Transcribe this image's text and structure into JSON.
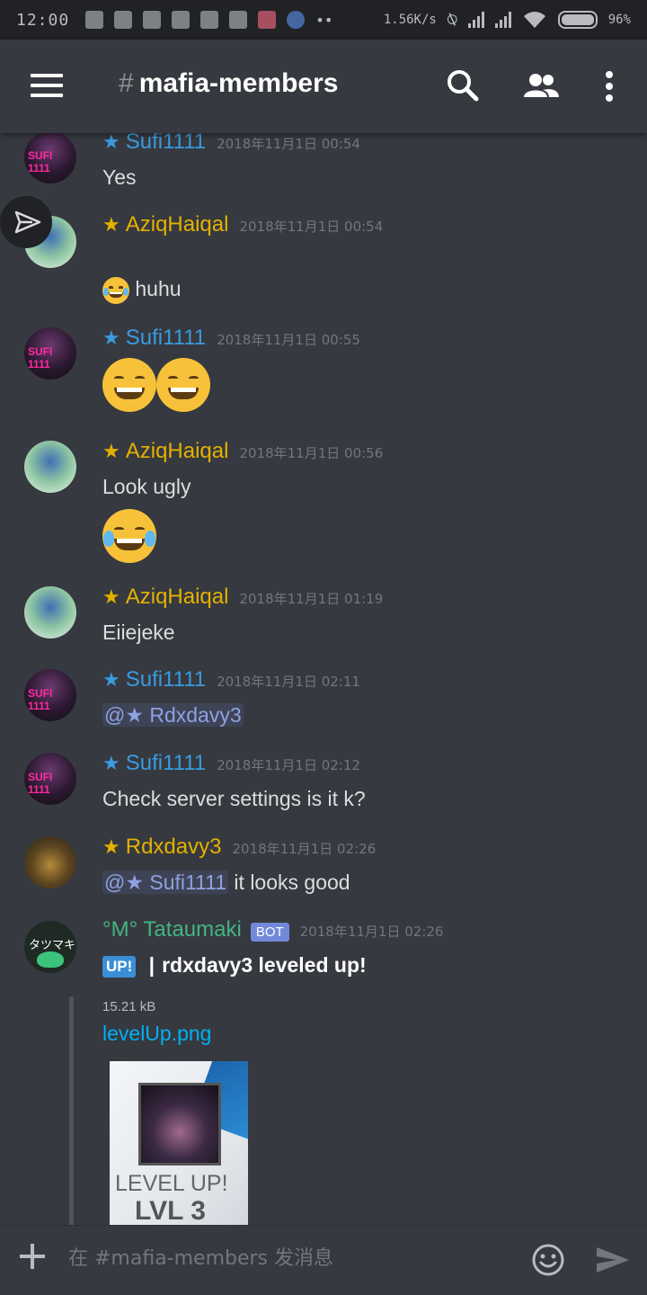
{
  "status_bar": {
    "time": "12:00",
    "network_speed": "1.56K/s",
    "battery": "96%"
  },
  "header": {
    "hash": "#",
    "channel": "mafia-members"
  },
  "messages": [
    {
      "author": "Sufi1111",
      "role_star": "★",
      "color": "#3a9be0",
      "timestamp": "2018年11月1日 00:54",
      "text": "Yes",
      "avatar": "sufi-avatar"
    },
    {
      "author": "AziqHaiqal",
      "role_star": "★",
      "color": "#e3b100",
      "timestamp": "2018年11月1日 00:54",
      "text": "huhu",
      "emoji_before_text": "sob-emoji",
      "avatar": "aziq-avatar"
    },
    {
      "author": "Sufi1111",
      "role_star": "★",
      "color": "#3a9be0",
      "timestamp": "2018年11月1日 00:55",
      "emojis": [
        "grin-emoji",
        "grin-emoji"
      ],
      "avatar": "sufi-avatar"
    },
    {
      "author": "AziqHaiqal",
      "role_star": "★",
      "color": "#e3b100",
      "timestamp": "2018年11月1日 00:56",
      "text": "Look ugly",
      "emojis": [
        "joy-emoji"
      ],
      "avatar": "aziq-avatar"
    },
    {
      "author": "AziqHaiqal",
      "role_star": "★",
      "color": "#e3b100",
      "timestamp": "2018年11月1日 01:19",
      "text": "Eiiejeke",
      "avatar": "aziq-avatar"
    },
    {
      "author": "Sufi1111",
      "role_star": "★",
      "color": "#3a9be0",
      "timestamp": "2018年11月1日 02:11",
      "mention": "@★ Rdxdavy3",
      "avatar": "sufi-avatar"
    },
    {
      "author": "Sufi1111",
      "role_star": "★",
      "color": "#3a9be0",
      "timestamp": "2018年11月1日 02:12",
      "text": "Check server settings is it k?",
      "avatar": "sufi-avatar"
    },
    {
      "author": "Rdxdavy3",
      "role_star": "★",
      "color": "#e3b100",
      "timestamp": "2018年11月1日 02:26",
      "mention": "@★ Sufi1111",
      "text": " it looks good",
      "avatar": "rdx-avatar"
    },
    {
      "author": "°M° Tataumaki",
      "bot_tag": "BOT",
      "color": "#43b581",
      "timestamp": "2018年11月1日 02:26",
      "badge": "UP!",
      "separator": "|",
      "text": "rdxdavy3 leveled up!",
      "avatar": "tatsumaki-avatar",
      "avatar_text": "タツマキ"
    }
  ],
  "attachment": {
    "size": "15.21 kB",
    "filename": "levelUp.png",
    "image_text_title": "LEVEL UP!",
    "image_text_level": "LVL 3"
  },
  "input": {
    "placeholder": "在 #mafia-members 发消息"
  }
}
